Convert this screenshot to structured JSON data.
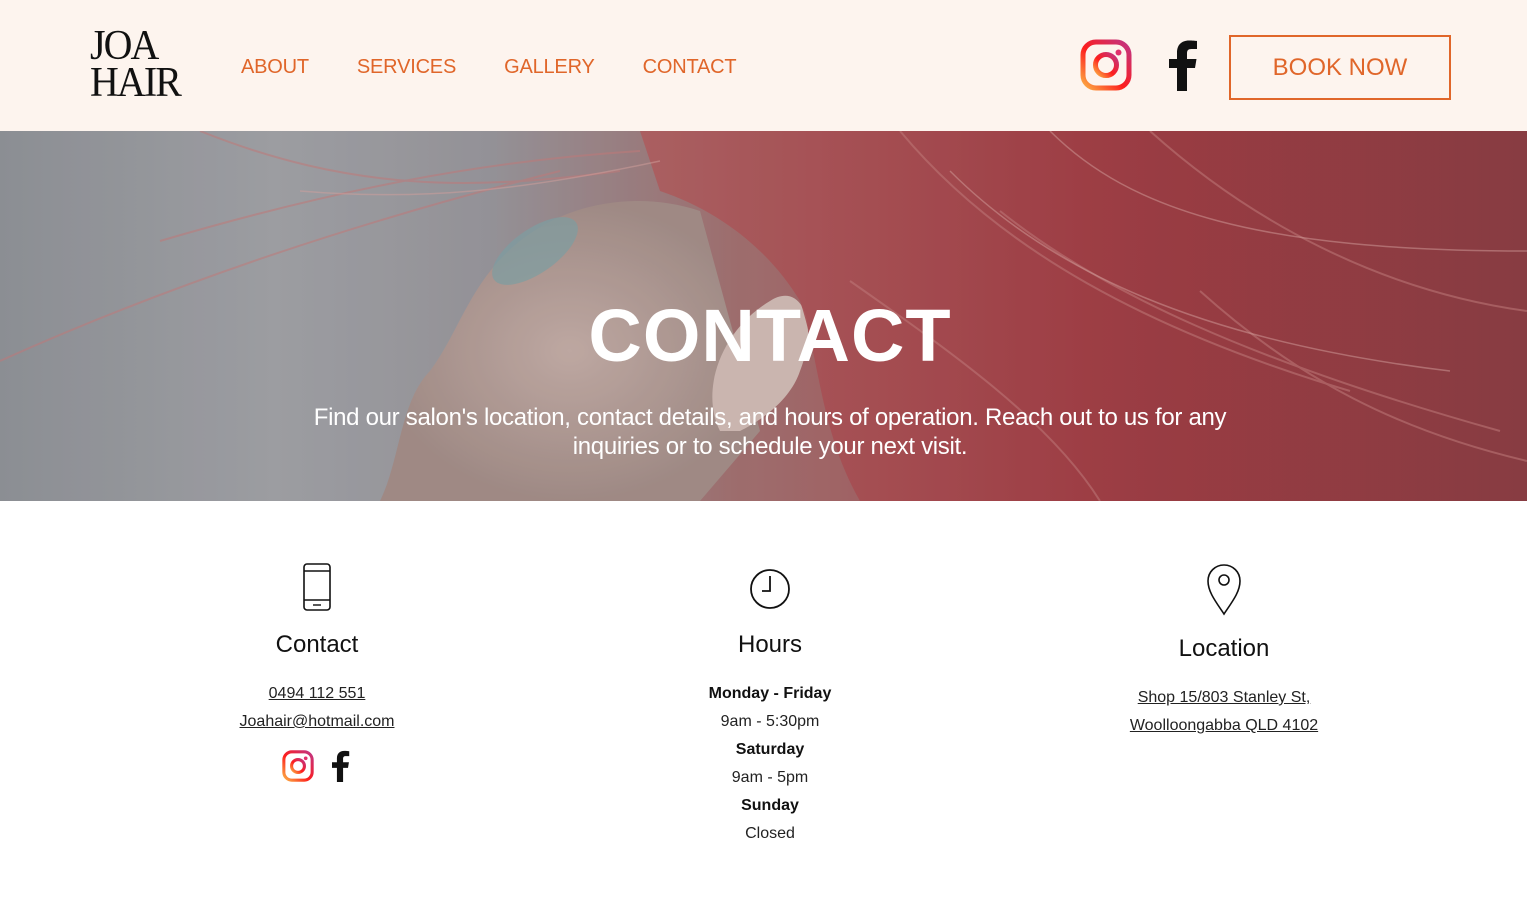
{
  "brand": {
    "logo_line1": "JOA",
    "logo_line2": "HAIR"
  },
  "nav": {
    "items": [
      {
        "label": "ABOUT"
      },
      {
        "label": "SERVICES"
      },
      {
        "label": "GALLERY"
      },
      {
        "label": "CONTACT"
      }
    ]
  },
  "header": {
    "social_icons": [
      "instagram-icon",
      "facebook-icon"
    ],
    "book_label": "BOOK NOW"
  },
  "hero": {
    "title": "CONTACT",
    "subtitle": "Find our salon's location, contact details, and hours of operation. Reach out to us for any inquiries or to schedule your next visit."
  },
  "contact": {
    "icon": "phone-icon",
    "heading": "Contact",
    "phone": "0494 112 551",
    "email": "Joahair@hotmail.com",
    "social_icons": [
      "instagram-icon",
      "facebook-icon"
    ]
  },
  "hours": {
    "icon": "clock-icon",
    "heading": "Hours",
    "rows": [
      {
        "day": "Monday - Friday",
        "time": "9am - 5:30pm"
      },
      {
        "day": "Saturday",
        "time": "9am - 5pm"
      },
      {
        "day": "Sunday",
        "time": "Closed"
      }
    ]
  },
  "location": {
    "icon": "map-pin-icon",
    "heading": "Location",
    "address_line1": "Shop 15/803 Stanley St,",
    "address_line2": "Woolloongabba QLD 4102"
  },
  "colors": {
    "accent": "#e0662a",
    "header_bg": "#fdf4ee",
    "text": "#111111"
  }
}
